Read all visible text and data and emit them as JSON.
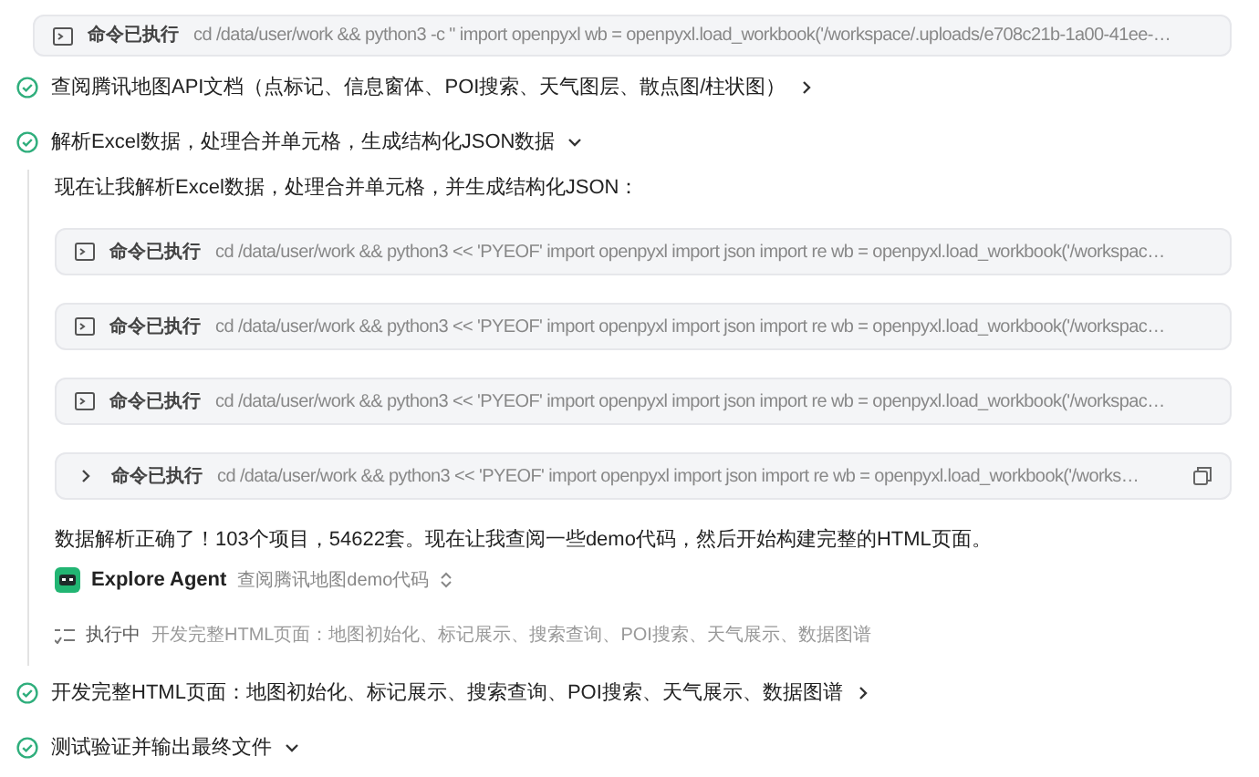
{
  "command": {
    "label": "命令已执行",
    "text": "cd /data/user/work && python3 -c \" import openpyxl wb = openpyxl.load_workbook('/workspace/.uploads/e708c21b-1a00-41ee-…",
    "hovered": false
  },
  "steps": [
    {
      "title": "查阅腾讯地图API文档（点标记、信息窗体、POI搜索、天气图层、散点图/柱状图）",
      "done": true,
      "expanded": false
    },
    {
      "title": "解析Excel数据，处理合并单元格，生成结构化JSON数据",
      "done": true,
      "expanded": true,
      "children": [
        {
          "kind": "text",
          "text": "现在让我解析Excel数据，处理合并单元格，并生成结构化JSON："
        },
        {
          "kind": "command",
          "label": "命令已执行",
          "text": "cd /data/user/work && python3 << 'PYEOF' import openpyxl import json import re wb = openpyxl.load_workbook('/workspac…",
          "hovered": false
        },
        {
          "kind": "command",
          "label": "命令已执行",
          "text": "cd /data/user/work && python3 << 'PYEOF' import openpyxl import json import re wb = openpyxl.load_workbook('/workspac…",
          "hovered": false
        },
        {
          "kind": "command",
          "label": "命令已执行",
          "text": "cd /data/user/work && python3 << 'PYEOF' import openpyxl import json import re wb = openpyxl.load_workbook('/workspac…",
          "hovered": false
        },
        {
          "kind": "command",
          "label": "命令已执行",
          "text": "cd /data/user/work && python3 << 'PYEOF' import openpyxl import json import re wb = openpyxl.load_workbook('/works…",
          "hovered": true
        },
        {
          "kind": "text",
          "text": "数据解析正确了！103个项目，54622套。现在让我查阅一些demo代码，然后开始构建完整的HTML页面。"
        },
        {
          "kind": "agent",
          "name": "Explore Agent",
          "text": "查阅腾讯地图demo代码"
        },
        {
          "kind": "running",
          "label": "执行中",
          "text": "开发完整HTML页面：地图初始化、标记展示、搜索查询、POI搜索、天气展示、数据图谱"
        }
      ]
    },
    {
      "title": "开发完整HTML页面：地图初始化、标记展示、搜索查询、POI搜索、天气展示、数据图谱",
      "done": true,
      "expanded": false
    },
    {
      "title": "测试验证并输出最终文件",
      "done": true,
      "expanded": true
    }
  ]
}
